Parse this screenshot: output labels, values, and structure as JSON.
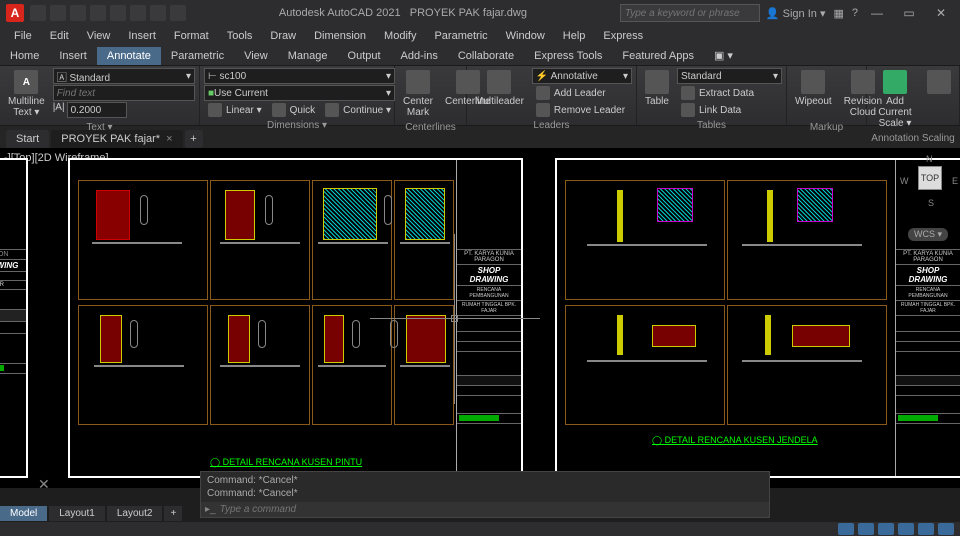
{
  "title": {
    "app": "Autodesk AutoCAD 2021",
    "file": "PROYEK PAK fajar.dwg",
    "logo": "A"
  },
  "search_placeholder": "Type a keyword or phrase",
  "signin": "Sign In",
  "menus": [
    "File",
    "Edit",
    "View",
    "Insert",
    "Format",
    "Tools",
    "Draw",
    "Dimension",
    "Modify",
    "Parametric",
    "Window",
    "Help",
    "Express"
  ],
  "ribbon_tabs": [
    "Home",
    "Insert",
    "Annotate",
    "Parametric",
    "View",
    "Manage",
    "Output",
    "Add-ins",
    "Collaborate",
    "Express Tools",
    "Featured Apps"
  ],
  "ribbon_active": 2,
  "ribbon": {
    "text": {
      "label": "Text ▾",
      "btn": "Multiline\nText ▾",
      "style": "Standard",
      "find": "Find text",
      "height": "0.2000"
    },
    "dimensions": {
      "label": "Dimensions ▾",
      "dimstyle": "sc100",
      "usecurrent": "Use Current",
      "linear": "Linear ▾",
      "quick": "Quick",
      "continue": "Continue ▾"
    },
    "centerlines": {
      "label": "Centerlines",
      "b1": "Center\nMark",
      "b2": "Centerline"
    },
    "leaders": {
      "label": "Leaders",
      "btn": "Multileader",
      "style": "Annotative",
      "add": "Add Leader",
      "remove": "Remove Leader"
    },
    "tables": {
      "label": "Tables",
      "btn": "Table",
      "style": "Standard",
      "extract": "Extract Data",
      "link": "Link Data"
    },
    "markup": {
      "label": "Markup",
      "b1": "Wipeout",
      "b2": "Revision\nCloud"
    },
    "scaling": {
      "label": "Annotation Scaling",
      "btn": "Add\nCurrent Scale ▾"
    }
  },
  "file_tabs": {
    "start": "Start",
    "file": "PROYEK PAK fajar*"
  },
  "view_label": "-][Top][2D Wireframe]",
  "viewcube": {
    "top": "TOP",
    "n": "N",
    "e": "E",
    "s": "S",
    "w": "W",
    "wcs": "WCS ▾"
  },
  "sheet1": {
    "company": "PT. KARYA KUNIA PARAGON",
    "drawing": "SHOP DRAWING",
    "project1": "RENCANA PEMBANGUNAN",
    "project2": "RUMAH TINGGAL BPK. FAJAR",
    "detail_title": "DETAIL RENCANA KUSEN PINTU"
  },
  "sheet2": {
    "company": "PT. KARYA KUNIA PARAGON",
    "drawing": "SHOP DRAWING",
    "project1": "RENCANA PEMBANGUNAN",
    "project2": "RUMAH TINGGAL BPK. FAJAR",
    "detail_title": "DETAIL RENCANA KUSEN JENDELA"
  },
  "sheet0": {
    "drawing": "DRAWING",
    "l1": "GUNAN",
    "l2": "PK. FAJAR"
  },
  "cmd": {
    "h1": "Command: *Cancel*",
    "h2": "Command: *Cancel*",
    "prompt": "▸_",
    "placeholder": "Type a command"
  },
  "layout_tabs": [
    "Model",
    "Layout1",
    "Layout2"
  ],
  "layout_active": 0
}
